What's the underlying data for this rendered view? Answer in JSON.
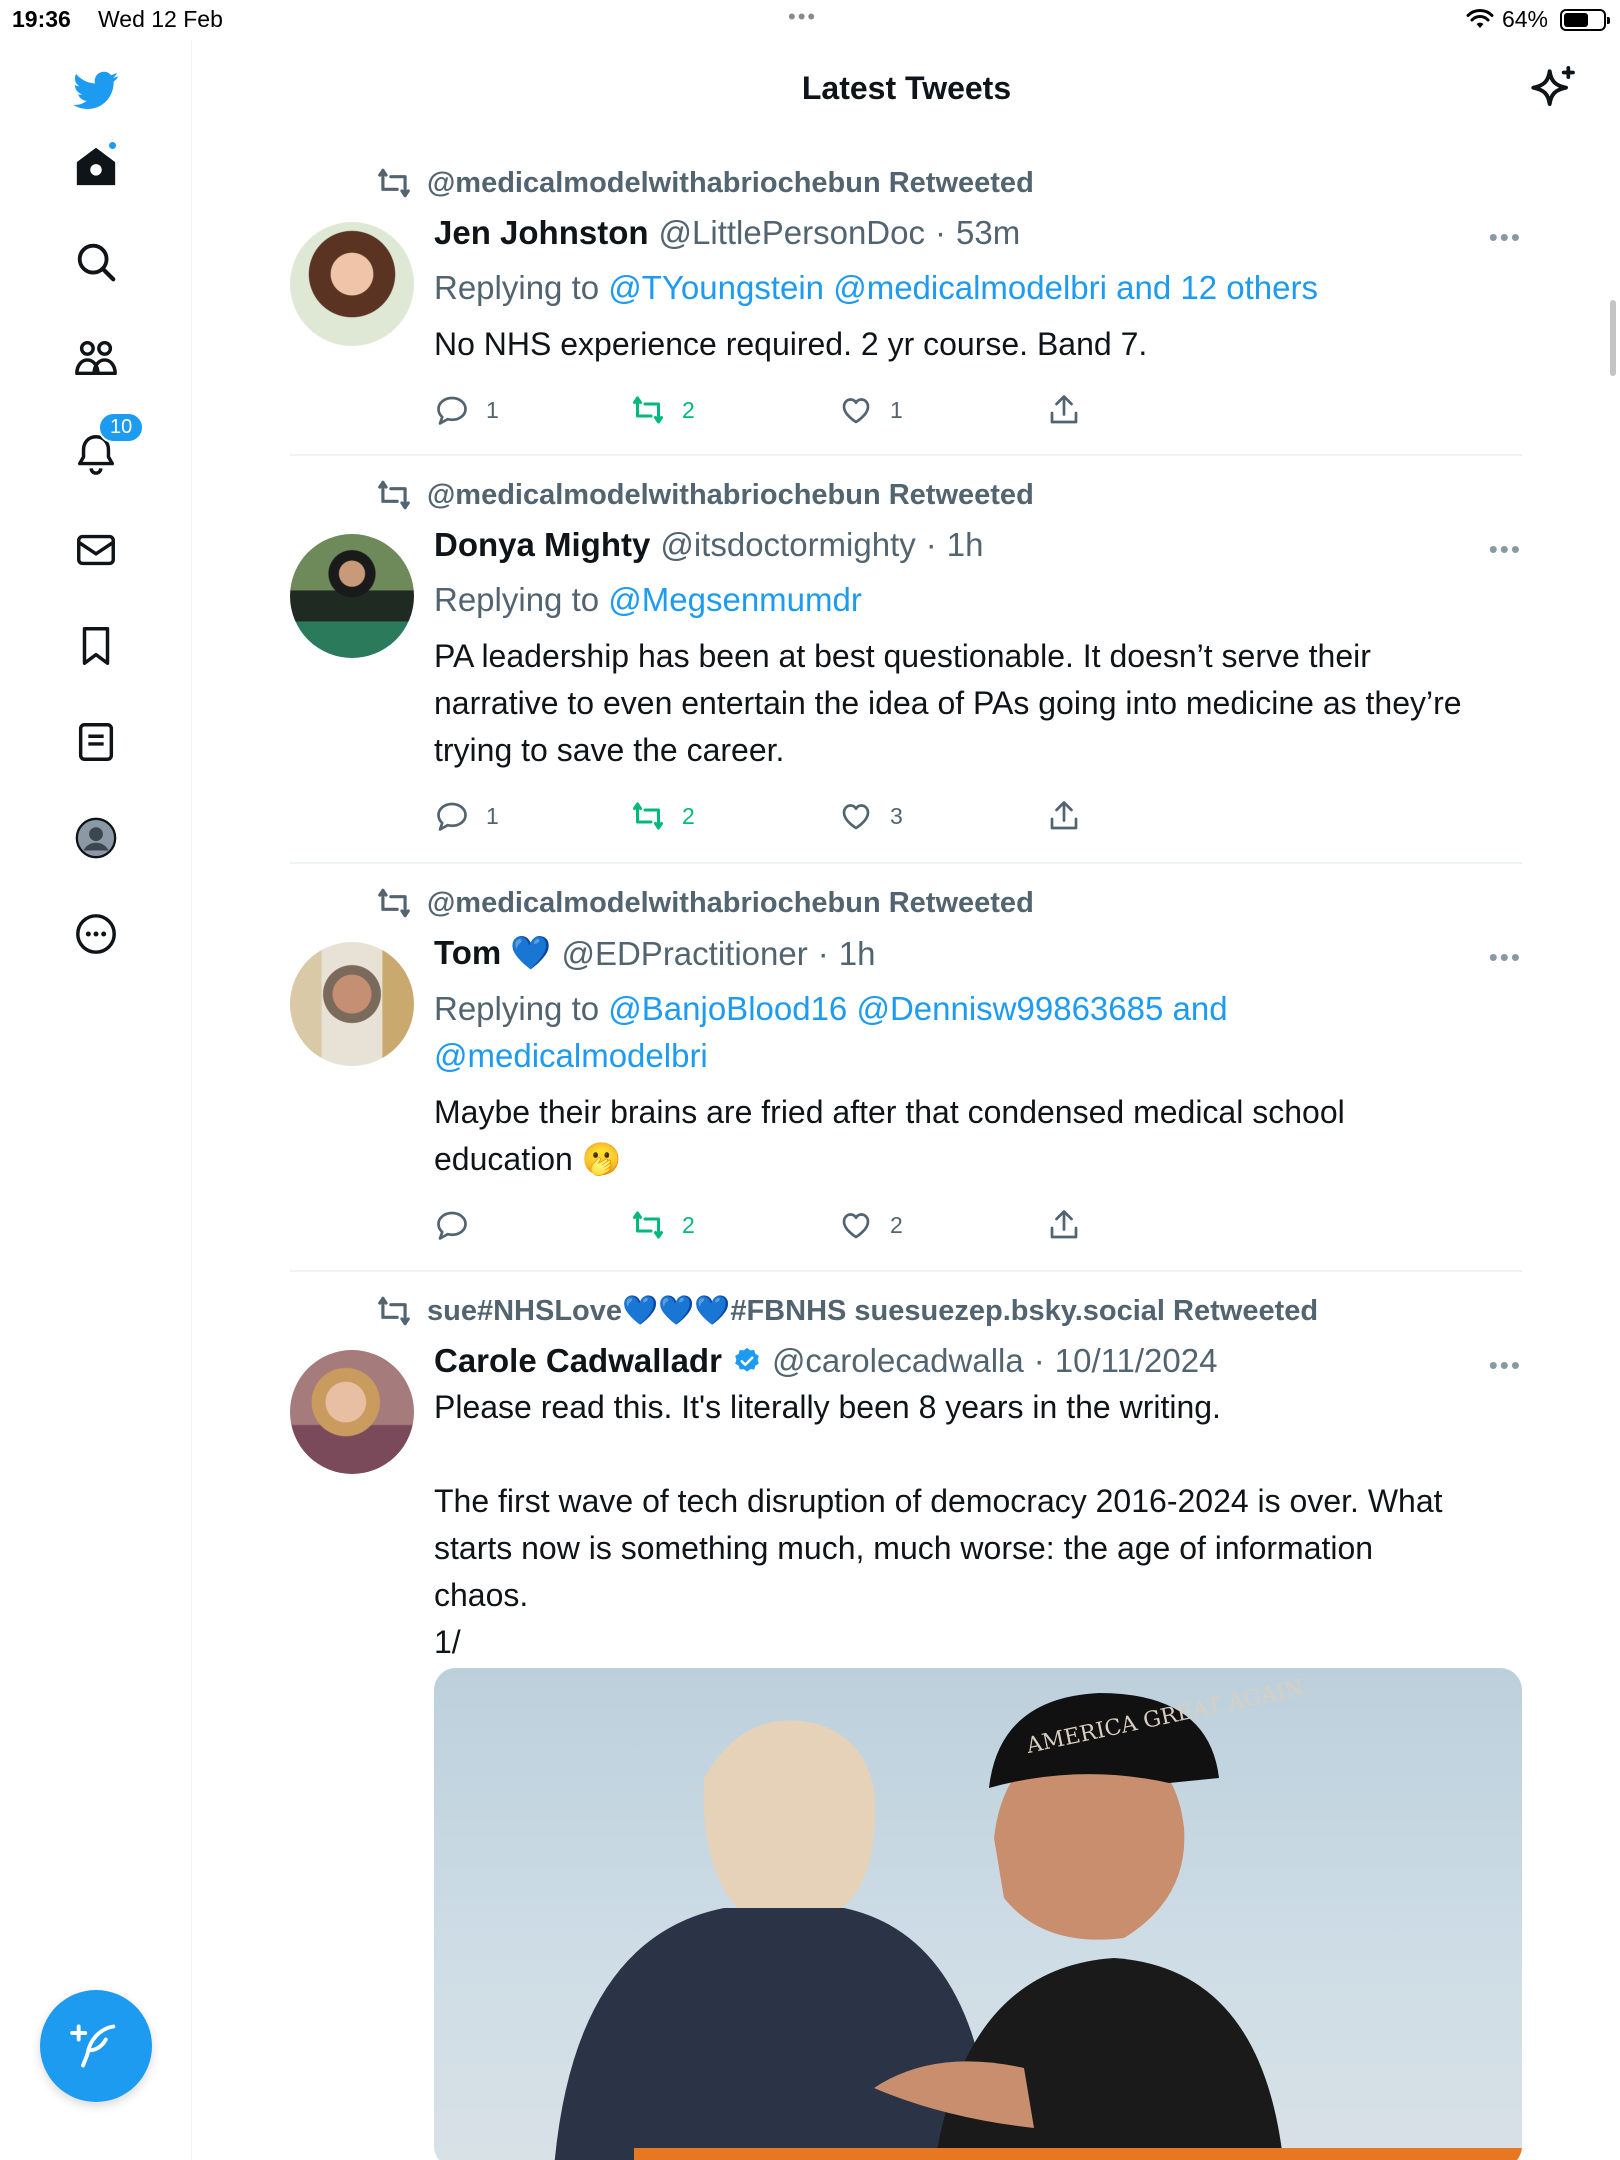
{
  "status_bar": {
    "time": "19:36",
    "date": "Wed 12 Feb",
    "battery_text": "64%",
    "battery_level": 0.64
  },
  "header": {
    "title": "Latest Tweets",
    "sparkle_icon": "sparkle-icon"
  },
  "sidebar": {
    "items": [
      {
        "name": "twitter-logo-icon"
      },
      {
        "name": "home-icon"
      },
      {
        "name": "search-icon"
      },
      {
        "name": "communities-icon"
      },
      {
        "name": "notifications-icon",
        "badge": "10"
      },
      {
        "name": "messages-icon"
      },
      {
        "name": "bookmarks-icon"
      },
      {
        "name": "lists-icon"
      },
      {
        "name": "profile-icon"
      },
      {
        "name": "more-icon"
      }
    ],
    "compose_icon": "compose-icon"
  },
  "tweets": [
    {
      "retweeted_by": "@medicalmodelwithabriochebun Retweeted",
      "name": "Jen Johnston",
      "handle": "@LittlePersonDoc",
      "time": "53m",
      "replying_prefix": "Replying to",
      "replying_to": "@TYoungstein @medicalmodelbri and 12 others",
      "text": "No NHS experience required. 2 yr course. Band 7.",
      "replies": "1",
      "retweets": "2",
      "likes": "1"
    },
    {
      "retweeted_by": "@medicalmodelwithabriochebun Retweeted",
      "name": "Donya Mighty",
      "handle": "@itsdoctormighty",
      "time": "1h",
      "replying_prefix": "Replying to",
      "replying_to": "@Megsenmumdr",
      "text": "PA leadership has been at best questionable. It doesn’t serve their narrative to even entertain the idea of PAs going into medicine as they’re trying to save the career.",
      "replies": "1",
      "retweets": "2",
      "likes": "3"
    },
    {
      "retweeted_by": "@medicalmodelwithabriochebun Retweeted",
      "name": "Tom 💙",
      "handle": "@EDPractitioner",
      "time": "1h",
      "replying_prefix": "Replying to",
      "replying_to": "@BanjoBlood16 @Dennisw99863685 and @medicalmodelbri",
      "text": "Maybe their brains are fried after that condensed medical school education 🫢",
      "replies": "",
      "retweets": "2",
      "likes": "2"
    },
    {
      "retweeted_by": "sue#NHSLove💙💙💙#FBNHS suesuezep.bsky.social Retweeted",
      "name": "Carole Cadwalladr",
      "handle": "@carolecadwalla",
      "time": "10/11/2024",
      "text_lines": [
        "Please read this. It's literally been 8 years in the writing.",
        "",
        "The first wave of tech disruption of democracy 2016-2024 is over. What starts now is something much, much worse: the age of information chaos.",
        "1/"
      ],
      "media_caption": "AMERICA GREAT AGAIN"
    }
  ],
  "colors": {
    "accent": "#1d9bf0",
    "retweet_green": "#00ba7c",
    "secondary_text": "#536471",
    "divider": "#eff3f4"
  }
}
